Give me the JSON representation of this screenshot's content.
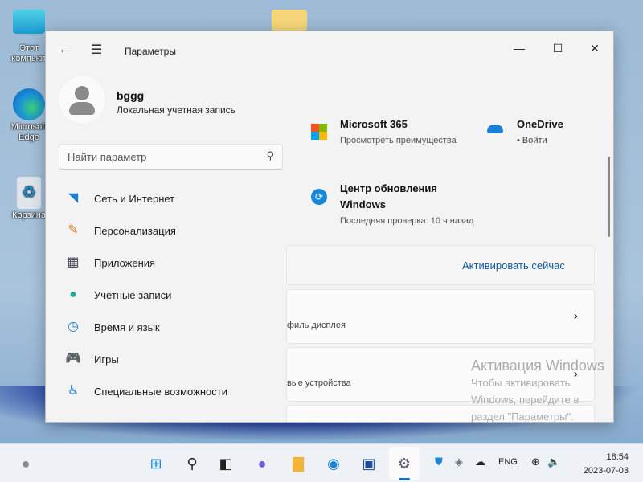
{
  "desktop": {
    "icons": [
      {
        "label": "Этот компьют"
      },
      {
        "label": "Microsoft Edge"
      },
      {
        "label": "Корзина"
      }
    ]
  },
  "window": {
    "title": "Параметры",
    "minimize": "—",
    "maximize": "☐",
    "close": "✕"
  },
  "user": {
    "name": "bggg",
    "type": "Локальная учетная запись"
  },
  "search": {
    "placeholder": "Найти параметр"
  },
  "nav": [
    {
      "label": "Сеть и Интернет",
      "icon": "wifi-icon"
    },
    {
      "label": "Персонализация",
      "icon": "brush-icon"
    },
    {
      "label": "Приложения",
      "icon": "apps-icon"
    },
    {
      "label": "Учетные записи",
      "icon": "person-icon"
    },
    {
      "label": "Время и язык",
      "icon": "clock-globe-icon"
    },
    {
      "label": "Игры",
      "icon": "gamepad-icon"
    },
    {
      "label": "Специальные возможности",
      "icon": "accessibility-icon"
    }
  ],
  "tiles": {
    "m365": {
      "title": "Microsoft 365",
      "sub": "Просмотреть преимущества"
    },
    "onedrive": {
      "title": "OneDrive",
      "sub": "• Войти"
    },
    "update": {
      "title1": "Центр обновления",
      "title2": "Windows",
      "sub": "Последняя проверка: 10 ч назад"
    }
  },
  "cards": {
    "activate_link": "Активировать сейчас",
    "display_sub": "филь дисплея",
    "devices_sub": "вые устройства"
  },
  "watermark": {
    "title": "Активация Windows",
    "line1": "Чтобы активировать",
    "line2": "Windows, перейдите в",
    "line3": "раздел \"Параметры\"."
  },
  "taskbar": {
    "lang": "ENG",
    "time": "18:54",
    "date": "2023-07-03"
  }
}
